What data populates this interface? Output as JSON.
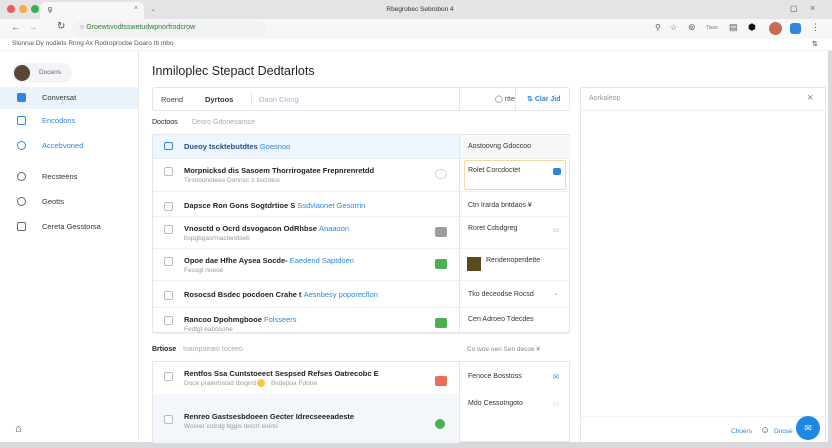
{
  "browser": {
    "tab_title": "g",
    "window_title": "Rbegrobec Sebrobon 4",
    "url": "Groewsvodtsswetudwpnorfrodcrow",
    "bookmarks": "Slonrse  Dy nodiets  Rnng Ax  Rodroprocbe  Doaro Ib mbo",
    "toolbar_text": "Tisso"
  },
  "sidebar": {
    "profile": "Docens",
    "items": [
      {
        "label": "Conversat",
        "active": true
      },
      {
        "label": "Encodons"
      },
      {
        "label": "Accebvoned"
      },
      {
        "label": "Recsteens"
      },
      {
        "label": "Geotts"
      },
      {
        "label": "Cereta Gesstorsa"
      }
    ]
  },
  "main": {
    "title": "Inmiloplec Stepact Dedtarlots",
    "toolbar": {
      "tab1": "Roend",
      "tab2": "Dyrtoos",
      "search_placeholder": "Daon Clong",
      "filter": "rtte",
      "cta": "Clar Jid"
    },
    "section1": {
      "label": "Doctoos",
      "sublabel": "Deoro Gdonesaroce",
      "header": "Dueoy tscktebutdtes",
      "header_link": "Goesnoo",
      "side_header": "Aostoovng  Gdoccoo",
      "rows": [
        {
          "title": "Morpnicksd dis Sasoem Thorrirogatee Frepnrenretdd",
          "link": "",
          "sub": "Tirsnoonotees Gonnsc  1 tisciotos",
          "side": "Rolet Corcdoctet",
          "badge": "shield",
          "badge_color": "#c9d6e6"
        },
        {
          "title": "Dapsce Ron Gons Sogtdrtioe S",
          "link": "Ssdvlaonet Gesorrin",
          "sub": "",
          "side": "Ctn Irarda bntdaos ¥",
          "badge": "",
          "badge_color": ""
        },
        {
          "title": "Vnosctd o Ocrd dsvogacon OdRhbse",
          "link": "Anaaoon",
          "sub": "bspgbgasrmacteridseb",
          "side": "Roret Cdsdgreg",
          "badge": "gray",
          "badge_color": "#9e9e9e"
        },
        {
          "title": "Opoe dae Hfhe Aysea Socde-",
          "link": "Eaedend Saptdoen",
          "sub": "Fessgt noeoe",
          "side": "Rendenoperdette",
          "badge": "green",
          "badge_color": "#4caf50"
        },
        {
          "title": "Rosocsd Bsdec pocdoen Crahe t",
          "link": "Aesnbesy poporecflon",
          "sub": "",
          "side": "Tko deceodse Rocsd",
          "badge": "",
          "badge_color": ""
        },
        {
          "title": "Rancoo Dpohmgbooe",
          "link": "Folsseers",
          "sub": "Fedtgt eabosone",
          "side": "Cen Adroeo Tdecdes",
          "badge": "green",
          "badge_color": "#4caf50"
        }
      ]
    },
    "section2": {
      "label": "Brtiose",
      "sublabel": "Ioampoeam toceeo",
      "right_link": "Co woe oen Sen decoe ¥",
      "rows": [
        {
          "title": "Rentfos Ssa Cuntstoeect Sespsed  Refses Oatrecobc E",
          "sub": "Doce praterbstad tbsgrrd",
          "sub2": "Bvdepoa Fdotre",
          "side": "Fenoce Bosstoss",
          "badge_color": "#ef6c57"
        },
        {
          "title": "Renreo Gastsesbdoeen Gecter Idrecseeeadeste",
          "sub": "Wosrer cotrdg  bggis  tescrt eiorto",
          "sub2": "",
          "side": "Mdo Cessotngoto",
          "badge_color": "#4caf50"
        }
      ]
    }
  },
  "panel": {
    "title": "Aorkaleop",
    "close": "Choers",
    "send": "Dnose"
  }
}
